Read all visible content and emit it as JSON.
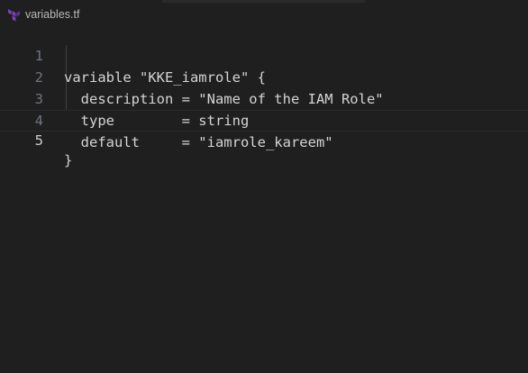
{
  "breadcrumb": {
    "icon": "terraform-icon",
    "filename": "variables.tf"
  },
  "colors": {
    "background": "#1f1f1f",
    "text": "#d4d4d4",
    "line_number": "#6e7681",
    "active_line_number": "#cccccc",
    "icon_accent": "#7b42bc"
  },
  "editor": {
    "lines": [
      {
        "number": "1",
        "text": "variable \"KKE_iamrole\" {"
      },
      {
        "number": "2",
        "text": "  description = \"Name of the IAM Role\""
      },
      {
        "number": "3",
        "text": "  type        = string"
      },
      {
        "number": "4",
        "text": "  default     = \"iamrole_kareem\""
      },
      {
        "number": "5",
        "text": "}"
      }
    ],
    "active_line": 5
  }
}
